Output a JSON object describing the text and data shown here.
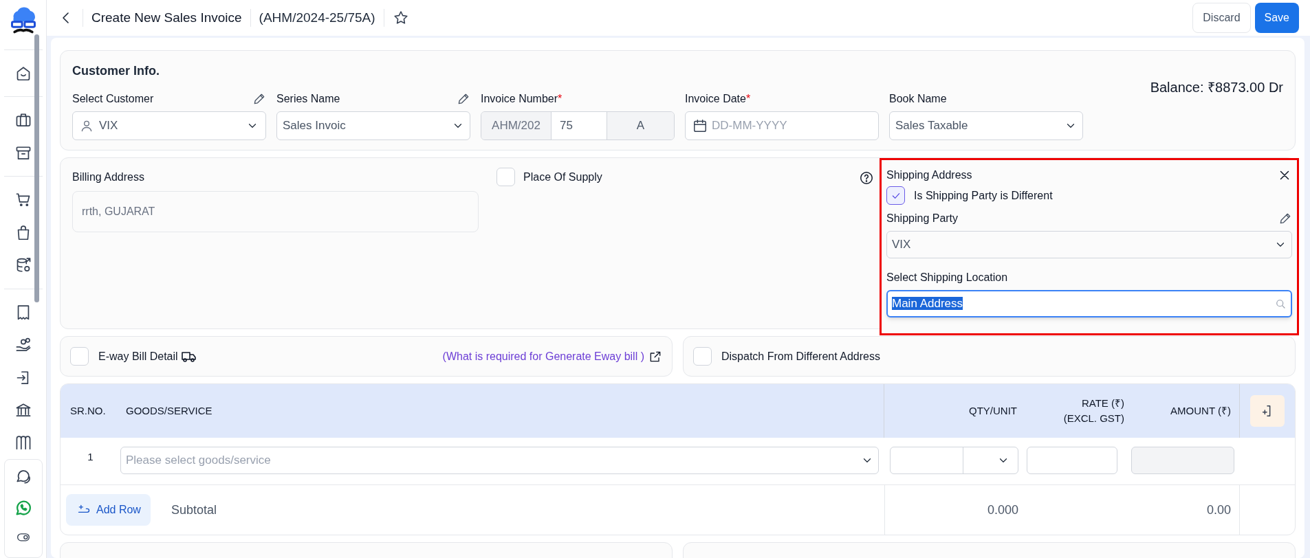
{
  "header": {
    "title": "Create New Sales Invoice",
    "invoice_ref": "(AHM/2024-25/75A)",
    "starred": false,
    "buttons": [
      "Discard",
      "Save"
    ]
  },
  "customer_info": {
    "heading": "Customer Info.",
    "balance": "Balance: ₹8873.00 Dr",
    "fields": [
      {
        "kind": "customer",
        "label": "Select Customer",
        "value": "VIX",
        "editable": true
      },
      {
        "kind": "select",
        "label": "Series Name",
        "value": "Sales Invoic",
        "editable": true
      },
      {
        "kind": "invoice_number",
        "label": "Invoice Number",
        "required_mark": "*",
        "parts": [
          "AHM/202",
          "75",
          "A"
        ]
      },
      {
        "kind": "date",
        "label": "Invoice Date",
        "required_mark": "*",
        "placeholder": "DD-MM-YYYY"
      },
      {
        "kind": "select",
        "label": "Book Name",
        "value": "Sales Taxable"
      }
    ]
  },
  "address": {
    "billing": {
      "label": "Billing Address",
      "value": "rrth, GUJARAT"
    },
    "place_of_supply": {
      "label": "Place Of Supply",
      "checked": false
    },
    "shipping": {
      "title": "Shipping Address",
      "different_party": {
        "label": "Is Shipping Party is Different",
        "checked": true
      },
      "party_label": "Shipping Party",
      "party_value": "VIX",
      "location_label": "Select Shipping Location",
      "location_value": "Main Address"
    }
  },
  "eway": {
    "label": "E-way Bill Detail",
    "checked": false,
    "link": "(What is required for Generate Eway bill )"
  },
  "dispatch": {
    "label": "Dispatch From Different Address",
    "checked": false
  },
  "table": {
    "columns": [
      "SR.NO.",
      "GOODS/SERVICE",
      "QTY/UNIT",
      "RATE (₹) (EXCL. GST)",
      "AMOUNT (₹)"
    ],
    "rows": [
      {
        "sr": "1",
        "goods_placeholder": "Please select goods/service"
      }
    ],
    "add_row": "Add Row",
    "subtotal_label": "Subtotal",
    "subtotal_qty": "0.000",
    "subtotal_amount": "0.00"
  }
}
